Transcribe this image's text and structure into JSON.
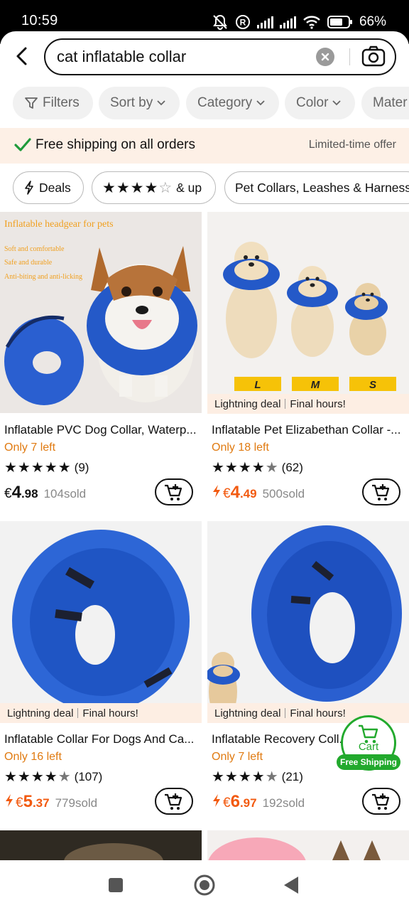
{
  "status_bar": {
    "time": "10:59",
    "battery": "66%"
  },
  "search": {
    "query": "cat inflatable collar"
  },
  "filter_chips": [
    "Filters",
    "Sort by",
    "Category",
    "Color",
    "Mater"
  ],
  "banner": {
    "text": "Free shipping on all orders",
    "side": "Limited-time offer"
  },
  "pills": {
    "deals": "Deals",
    "rating_suffix": "& up",
    "category": "Pet Collars, Leashes & Harness"
  },
  "products": [
    {
      "title": "Inflatable PVC Dog Collar, Waterp...",
      "stock": "Only 7 left",
      "reviews": "(9)",
      "currency": "€",
      "price_int": "4",
      "price_dec": ".98",
      "sold": "104sold",
      "deal": false,
      "image_text": {
        "headline": "Inflatable headgear for pets",
        "line1": "Soft and comfortable",
        "line2": "Safe and durable",
        "line3": "Anti-biting and anti-licking"
      }
    },
    {
      "title": "Inflatable Pet Elizabethan Collar -...",
      "stock": "Only 18 left",
      "reviews": "(62)",
      "currency": "€",
      "price_int": "4",
      "price_dec": ".49",
      "sold": "500sold",
      "deal": true,
      "sizes": [
        "L",
        "M",
        "S"
      ]
    },
    {
      "title": "Inflatable Collar For Dogs And Ca...",
      "stock": "Only 16 left",
      "reviews": "(107)",
      "currency": "€",
      "price_int": "5",
      "price_dec": ".37",
      "sold": "779sold",
      "deal": true
    },
    {
      "title": "Inflatable Recovery Coll...",
      "stock": "Only 7 left",
      "reviews": "(21)",
      "currency": "€",
      "price_int": "6",
      "price_dec": ".97",
      "sold": "192sold",
      "deal": true
    }
  ],
  "deal_strip": {
    "label": "Lightning deal",
    "sub": "Final hours!"
  },
  "floating_cart": {
    "label": "Cart",
    "badge": "Free Shipping"
  },
  "colors": {
    "accent_orange": "#f25a10",
    "stock_orange": "#e07a10",
    "green": "#22a92d",
    "banner_bg": "#fdf0e6"
  }
}
